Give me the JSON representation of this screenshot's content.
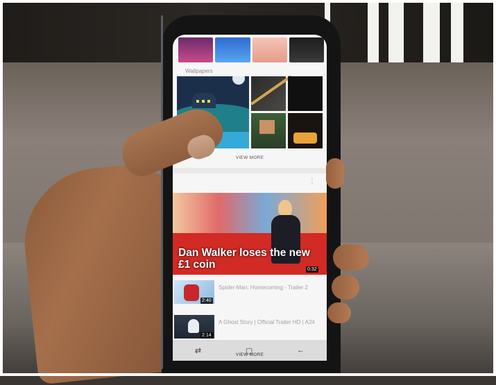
{
  "screen": {
    "wallpapers_label": "Wallpapers",
    "view_more_label": "VIEW MORE",
    "featured_video": {
      "title": "Dan Walker loses the new £1 coin",
      "duration": "0:32"
    },
    "videos": [
      {
        "title": "Spider-Man: Homecoming - Trailer 2",
        "duration": "2:40"
      },
      {
        "title": "A Ghost Story | Official Trailer HD | A24",
        "duration": "2:14"
      }
    ],
    "nav_caption": "VIEW MORE"
  },
  "icons": {
    "more": "more-vert-icon",
    "recent": "recent-apps-icon",
    "home": "home-icon",
    "back": "back-icon",
    "chevron": "chevron-up-icon"
  },
  "colors": {
    "screen_bg": "#f6f6f6",
    "video_bg": "#c8261f",
    "nav_bar": "#dcdcdc"
  }
}
